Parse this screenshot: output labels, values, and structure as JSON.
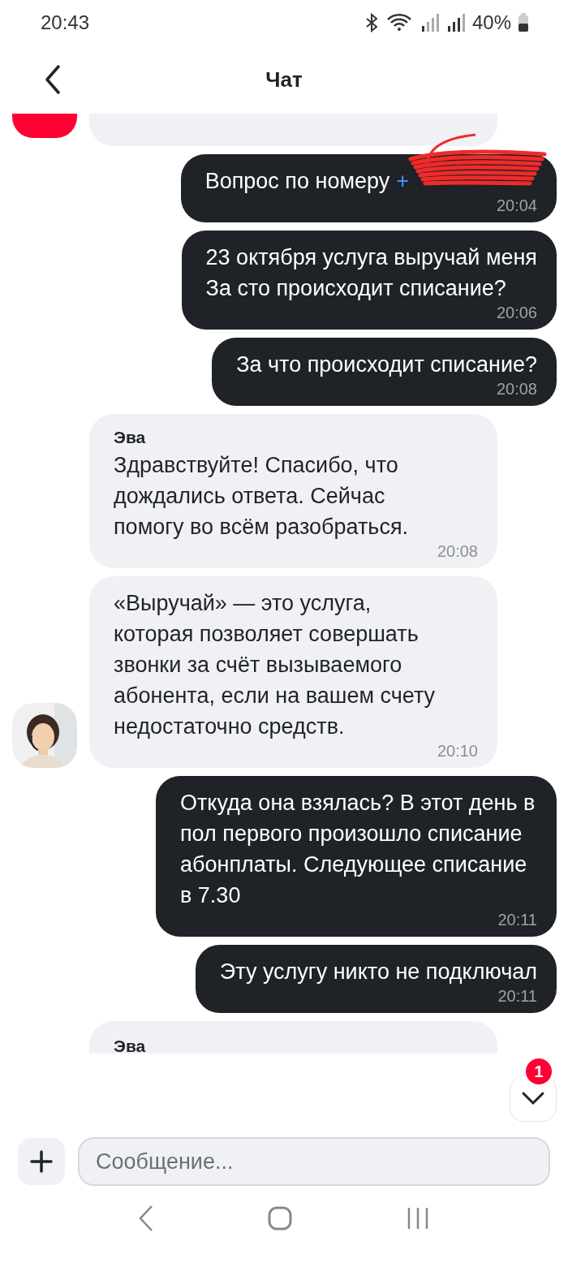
{
  "status_bar": {
    "time": "20:43",
    "battery": "40%"
  },
  "header": {
    "title": "Чат"
  },
  "messages": [
    {
      "kind": "partial"
    },
    {
      "kind": "out",
      "text": "Вопрос по номеру",
      "link": "+",
      "redacted": true,
      "time": "20:04"
    },
    {
      "kind": "out",
      "text": "23 октября услуга выручай меня\nЗа сто происходит списание?",
      "time": "20:06"
    },
    {
      "kind": "out",
      "text": "За что происходит списание?",
      "time": "20:08"
    },
    {
      "kind": "in",
      "sender": "Эва",
      "text": "Здравствуйте! Спасибо, что дождались ответа. Сейчас помогу во всём разобраться.",
      "time": "20:08",
      "avatar": false
    },
    {
      "kind": "in",
      "text": "«Выручай» — это услуга, которая позволяет совершать звонки за счёт вызываемого абонента, если на вашем счету недостаточно средств.",
      "time": "20:10",
      "avatar": true
    },
    {
      "kind": "out",
      "text": "Откуда она взялась? В этот день в пол первого произошло списание абонплаты. Следующее списание в 7.30",
      "time": "20:11"
    },
    {
      "kind": "out",
      "text": "Эту услугу никто не подключал",
      "time": "20:11"
    },
    {
      "kind": "cut",
      "sender": "Эва"
    }
  ],
  "scroll_button": {
    "badge": "1"
  },
  "composer": {
    "placeholder": "Сообщение..."
  }
}
